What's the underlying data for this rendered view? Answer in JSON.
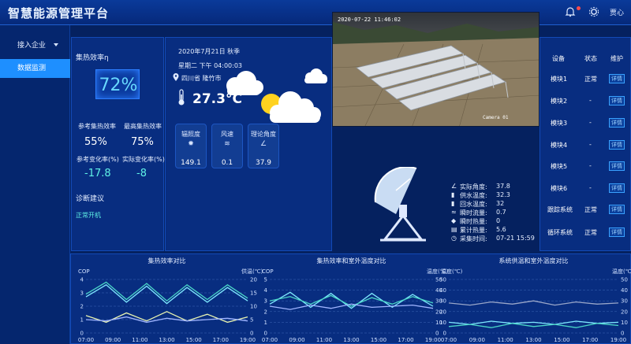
{
  "header": {
    "title": "智慧能源管理平台",
    "user": "贾心"
  },
  "sidebar": {
    "items": [
      {
        "label": "接入企业"
      },
      {
        "label": "数据监测"
      }
    ]
  },
  "left": {
    "efficiency_title": "集热效率η",
    "efficiency_value": "72%",
    "ref_eff_label": "参考集热效率",
    "ref_eff_value": "55%",
    "max_eff_label": "最高集热效率",
    "max_eff_value": "75%",
    "ref_change_label": "参考变化率(%)",
    "ref_change_value": "-17.8",
    "actual_change_label": "实际变化率(%)",
    "actual_change_value": "-8",
    "diag_title": "诊断建议",
    "diag_value": "正常开机"
  },
  "weather": {
    "date": "2020年7月21日 秋季",
    "time": "星期二 下午 04:00:03",
    "location": "四川省 隆竹市",
    "temperature": "27.3°C",
    "cards": [
      {
        "label": "辐照度",
        "value": "149.1"
      },
      {
        "label": "风速",
        "value": "0.1"
      },
      {
        "label": "理论角度",
        "value": "37.9"
      }
    ]
  },
  "camera": {
    "timestamp": "2020-07-22 11:46:02",
    "label": "Camera 01"
  },
  "sensors": [
    {
      "label": "实际角度:",
      "value": "37.8"
    },
    {
      "label": "供水温度:",
      "value": "32.3"
    },
    {
      "label": "回水温度:",
      "value": "32"
    },
    {
      "label": "瞬时流量:",
      "value": "0.7"
    },
    {
      "label": "瞬时热量:",
      "value": "0"
    },
    {
      "label": "累计热量:",
      "value": "5.6"
    },
    {
      "label": "采集时间:",
      "value": "07-21 15:59"
    }
  ],
  "devices": {
    "headers": [
      "设备",
      "状态",
      "维护"
    ],
    "rows": [
      {
        "name": "模块1",
        "status": "正常",
        "action": "详情"
      },
      {
        "name": "模块2",
        "status": "-",
        "action": "详情"
      },
      {
        "name": "模块3",
        "status": "-",
        "action": "详情"
      },
      {
        "name": "模块4",
        "status": "-",
        "action": "详情"
      },
      {
        "name": "模块5",
        "status": "-",
        "action": "详情"
      },
      {
        "name": "模块6",
        "status": "-",
        "action": "详情"
      },
      {
        "name": "跟踪系统",
        "status": "正常",
        "action": "详情"
      },
      {
        "name": "循环系统",
        "status": "正常",
        "action": "详情"
      }
    ]
  },
  "chart_data": [
    {
      "type": "line",
      "title": "集热效率对比",
      "ylabel": "COP",
      "y2label": "供温(℃)",
      "ylim": [
        0,
        4
      ],
      "y2lim": [
        0,
        20
      ],
      "x": [
        "07:00",
        "09:00",
        "11:00",
        "13:00",
        "15:00",
        "17:00",
        "19:00"
      ],
      "series": [
        {
          "values": [
            2.7,
            3.6,
            2.3,
            3.5,
            2.2,
            3.4,
            2.3,
            3.4,
            2.4
          ],
          "color": "#7fe9ff"
        },
        {
          "values": [
            2.9,
            3.8,
            2.5,
            3.7,
            2.4,
            3.6,
            2.5,
            3.6,
            2.6
          ],
          "color": "#4ad6c7"
        },
        {
          "values": [
            1.3,
            0.8,
            1.5,
            0.9,
            1.6,
            0.9,
            1.4,
            0.8,
            1.2
          ],
          "color": "#e8f3b0"
        },
        {
          "values": [
            1.0,
            0.9,
            1.2,
            0.8,
            1.1,
            0.9,
            1.0,
            1.1,
            0.9
          ],
          "color": "#9fb4ff"
        }
      ]
    },
    {
      "type": "line",
      "title": "集热效率和室外温度对比",
      "ylabel": "COP",
      "y2label": "温度(℃)",
      "ylim": [
        0,
        5
      ],
      "y2lim": [
        0,
        50
      ],
      "x": [
        "07:00",
        "09:00",
        "11:00",
        "13:00",
        "15:00",
        "17:00",
        "19:00"
      ],
      "series": [
        {
          "values": [
            2.7,
            3.8,
            2.4,
            3.7,
            2.3,
            3.7,
            2.4,
            3.6,
            2.5
          ],
          "color": "#7fe9ff"
        },
        {
          "values": [
            3.0,
            3.4,
            2.7,
            3.5,
            2.5,
            3.3,
            2.7,
            3.4,
            2.8
          ],
          "color": "#4ad6c7"
        },
        {
          "values": [
            2.5,
            2.2,
            2.6,
            2.3,
            2.7,
            2.4,
            2.5,
            2.6,
            2.3
          ],
          "color": "#9fb4ff"
        }
      ]
    },
    {
      "type": "line",
      "title": "系统供温和室外温度对比",
      "ylabel": "温度(℃)",
      "y2label": "温度(℃)",
      "ylim": [
        0,
        50
      ],
      "y2lim": [
        0,
        50
      ],
      "x": [
        "07:00",
        "09:00",
        "11:00",
        "13:00",
        "15:00",
        "17:00",
        "19:00"
      ],
      "series": [
        {
          "values": [
            28,
            26,
            29,
            27,
            30,
            26,
            29,
            27,
            28
          ],
          "color": "#9aa7c9"
        },
        {
          "values": [
            10,
            8,
            11,
            9,
            10,
            8,
            11,
            9,
            10
          ],
          "color": "#7fe9ff"
        },
        {
          "values": [
            6,
            8,
            5,
            9,
            6,
            8,
            5,
            9,
            7
          ],
          "color": "#4ad6c7"
        }
      ]
    }
  ],
  "colors": {
    "background": "#05215f",
    "accent": "#1e8fff",
    "cyan": "#5ff2e6"
  }
}
